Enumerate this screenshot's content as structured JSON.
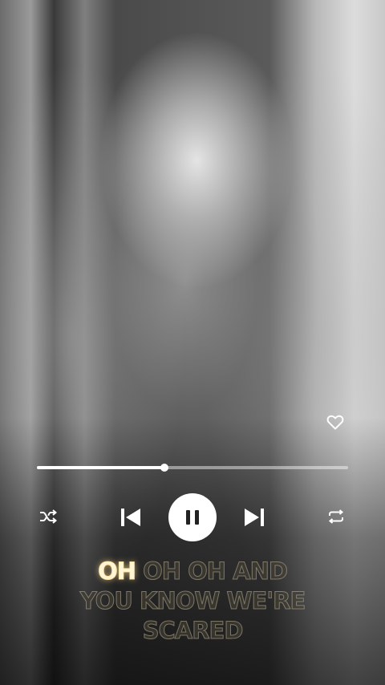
{
  "player": {
    "progress_fraction": 0.41,
    "liked": false
  },
  "controls": {
    "shuffle_icon": "shuffle-icon",
    "previous_icon": "skip-previous-icon",
    "play_pause_icon": "pause-icon",
    "next_icon": "skip-next-icon",
    "repeat_icon": "repeat-icon",
    "like_icon": "heart-icon"
  },
  "lyrics": {
    "active": "OH",
    "rest_line1": " OH OH AND",
    "line2": "YOU KNOW WE'RE",
    "line3": "SCARED"
  },
  "colors": {
    "accent": "#ffffff",
    "lyric_highlight": "#fff6d8"
  }
}
